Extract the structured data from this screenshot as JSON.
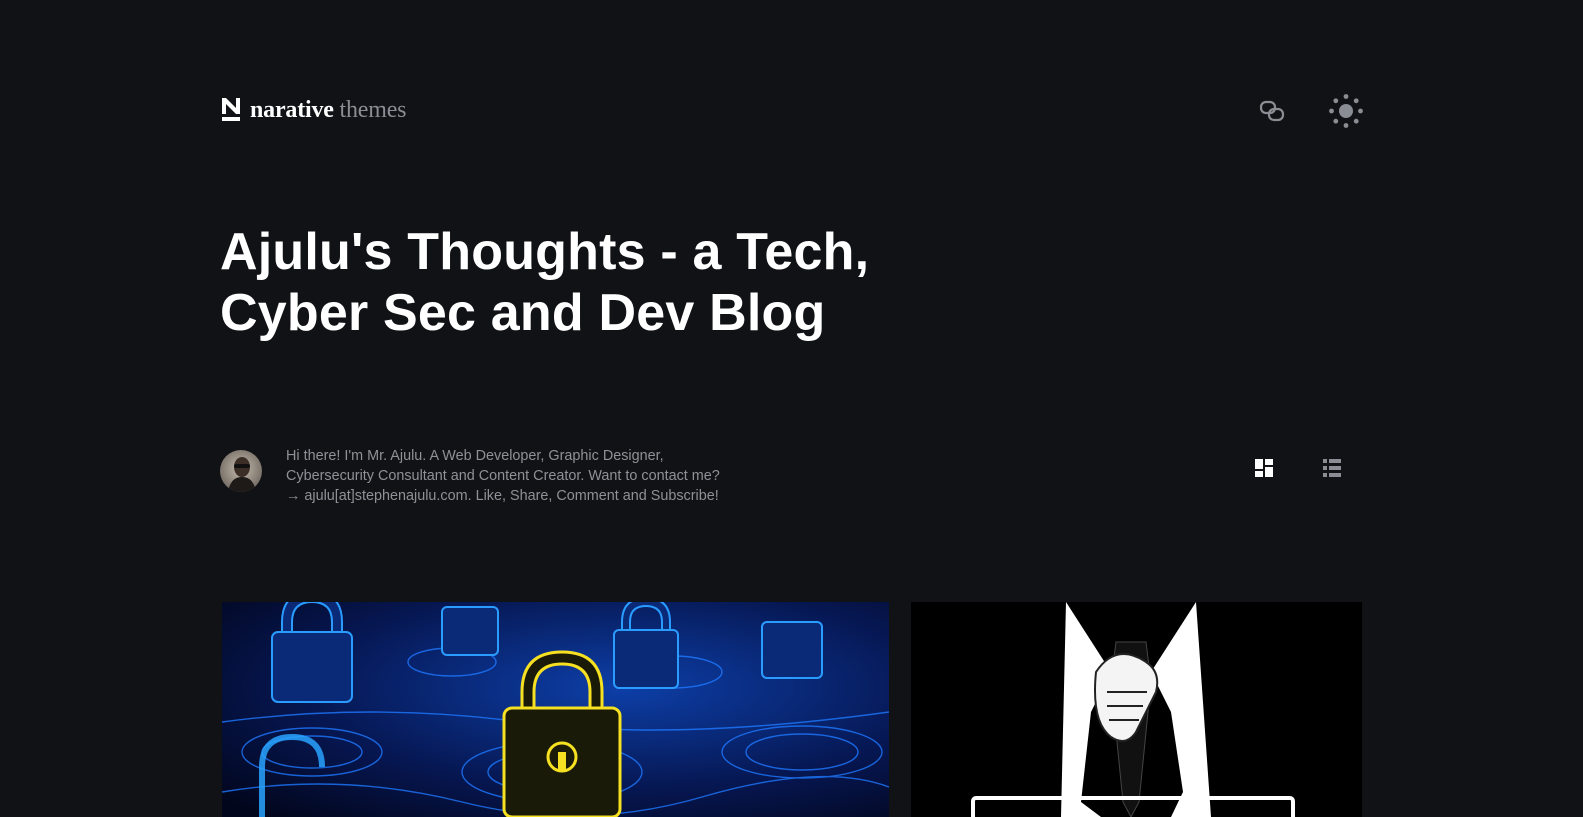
{
  "header": {
    "logo_primary": "narative",
    "logo_secondary": "themes",
    "icons": [
      "copy-link-icon",
      "theme-toggle-sun-icon"
    ]
  },
  "hero": {
    "title": "Ajulu's Thoughts - a Tech, Cyber Sec and Dev Blog"
  },
  "author": {
    "bio": "Hi there! I'm Mr. Ajulu. A Web Developer, Graphic Designer, Cybersecurity Consultant and Content Creator. Want to contact me? → ajulu[at]stephenajulu.com. Like, Share, Comment and Subscribe!",
    "avatar_icon": "avatar"
  },
  "layout_toggles": {
    "icons": [
      "grid-layout-icon",
      "list-layout-icon"
    ],
    "active": "grid"
  },
  "articles": [
    {
      "image_icon": "cyber-padlocks-image"
    },
    {
      "image_icon": "anonymous-suit-image"
    }
  ],
  "colors": {
    "background": "#111216",
    "title": "#ffffff",
    "muted_text": "#8e9197",
    "icon": "#8a8d93"
  }
}
